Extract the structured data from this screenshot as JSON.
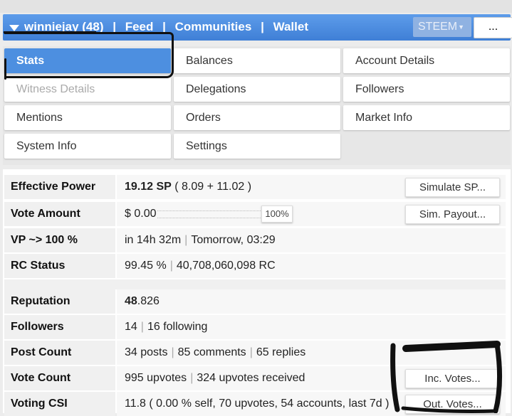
{
  "header": {
    "user": "winniejay (48)",
    "sep": "|",
    "feed": "Feed",
    "communities": "Communities",
    "wallet": "Wallet",
    "chain_select": "STEEM",
    "more_button": "..."
  },
  "menu": {
    "stats": "Stats",
    "balances": "Balances",
    "account_details": "Account Details",
    "witness_details": "Witness Details",
    "delegations": "Delegations",
    "followers": "Followers",
    "mentions": "Mentions",
    "orders": "Orders",
    "market_info": "Market Info",
    "system_info": "System Info",
    "settings": "Settings"
  },
  "stats": {
    "effective_power": {
      "label": "Effective Power",
      "sp": "19.12 SP",
      "detail": "( 8.09 + 11.02 )",
      "button": "Simulate SP..."
    },
    "vote_amount": {
      "label": "Vote Amount",
      "value": "$ 0.00",
      "slider_pct": "100%",
      "button": "Sim. Payout..."
    },
    "vp": {
      "label": "VP ~> 100 %",
      "time": "in 14h 32m",
      "when": "Tomorrow, 03:29"
    },
    "rc": {
      "label": "RC Status",
      "pct": "99.45 %",
      "amount": "40,708,060,098 RC"
    },
    "reputation": {
      "label": "Reputation",
      "int": "48",
      "dec": ".826"
    },
    "followers": {
      "label": "Followers",
      "count": "14",
      "following": "16 following"
    },
    "post_count": {
      "label": "Post Count",
      "posts": "34 posts",
      "comments": "85 comments",
      "replies": "65 replies"
    },
    "vote_count": {
      "label": "Vote Count",
      "upvotes": "995 upvotes",
      "received": "324 upvotes received",
      "button": "Inc. Votes..."
    },
    "voting_csi": {
      "label": "Voting CSI",
      "value": "11.8 ( 0.00 % self, 70 upvotes, 54 accounts, last 7d )",
      "button": "Out. Votes..."
    }
  }
}
